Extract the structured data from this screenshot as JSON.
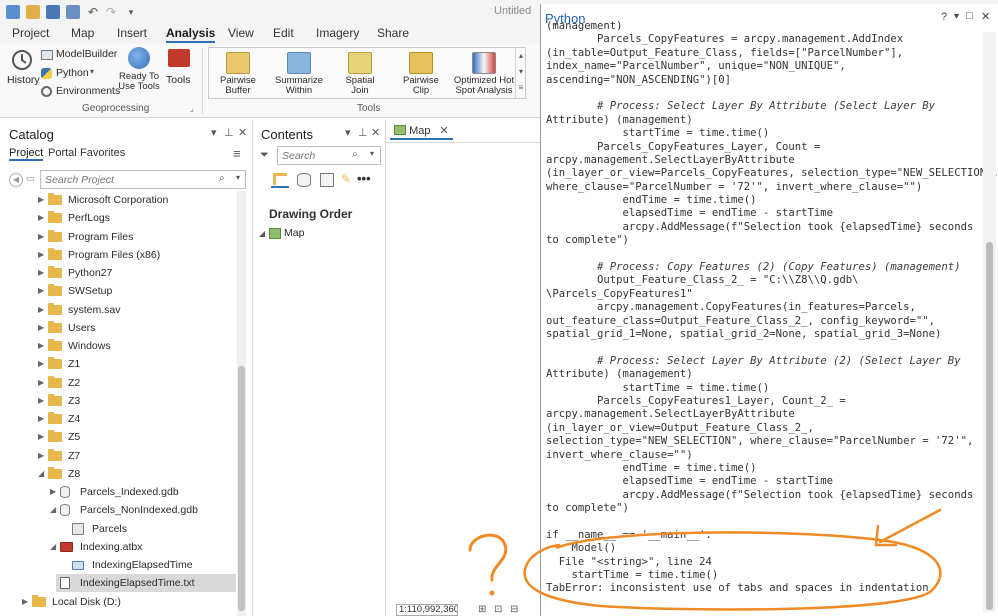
{
  "window": {
    "title": "Untitled",
    "quick_access": [
      "new-project-icon",
      "open-project-icon",
      "save-icon",
      "save-as-icon",
      "undo-icon",
      "redo-icon",
      "customize-icon"
    ]
  },
  "ribbon": {
    "tabs": [
      "Project",
      "Map",
      "Insert",
      "Analysis",
      "View",
      "Edit",
      "Imagery",
      "Share"
    ],
    "active_tab": "Analysis",
    "history_label": "History",
    "modelbuilder_label": "ModelBuilder",
    "python_label": "Python",
    "environments_label": "Environments",
    "ready_to_use_label": "Ready To\nUse Tools",
    "tools_label": "Tools",
    "geoprocessing_group": "Geoprocessing",
    "tools_group": "Tools",
    "tool_gallery": [
      {
        "label": "Pairwise\nBuffer"
      },
      {
        "label": "Summarize\nWithin"
      },
      {
        "label": "Spatial\nJoin"
      },
      {
        "label": "Pairwise\nClip"
      },
      {
        "label": "Optimized Hot\nSpot Analysis"
      }
    ]
  },
  "catalog": {
    "title": "Catalog",
    "subtabs": [
      "Project",
      "Portal",
      "Favorites"
    ],
    "search_placeholder": "Search Project",
    "items": [
      {
        "label": "Microsoft Corporation",
        "type": "folder",
        "indent": 0,
        "expanded": false
      },
      {
        "label": "PerfLogs",
        "type": "folder",
        "indent": 0,
        "expanded": false
      },
      {
        "label": "Program Files",
        "type": "folder",
        "indent": 0,
        "expanded": false
      },
      {
        "label": "Program Files (x86)",
        "type": "folder",
        "indent": 0,
        "expanded": false
      },
      {
        "label": "Python27",
        "type": "folder",
        "indent": 0,
        "expanded": false
      },
      {
        "label": "SWSetup",
        "type": "folder",
        "indent": 0,
        "expanded": false
      },
      {
        "label": "system.sav",
        "type": "folder",
        "indent": 0,
        "expanded": false
      },
      {
        "label": "Users",
        "type": "folder",
        "indent": 0,
        "expanded": false
      },
      {
        "label": "Windows",
        "type": "folder",
        "indent": 0,
        "expanded": false
      },
      {
        "label": "Z1",
        "type": "folder",
        "indent": 0,
        "expanded": false
      },
      {
        "label": "Z2",
        "type": "folder",
        "indent": 0,
        "expanded": false
      },
      {
        "label": "Z3",
        "type": "folder",
        "indent": 0,
        "expanded": false
      },
      {
        "label": "Z4",
        "type": "folder",
        "indent": 0,
        "expanded": false
      },
      {
        "label": "Z5",
        "type": "folder",
        "indent": 0,
        "expanded": false
      },
      {
        "label": "Z7",
        "type": "folder",
        "indent": 0,
        "expanded": false
      },
      {
        "label": "Z8",
        "type": "folder",
        "indent": 0,
        "expanded": true
      },
      {
        "label": "Parcels_Indexed.gdb",
        "type": "gdb",
        "indent": 1,
        "expanded": false
      },
      {
        "label": "Parcels_NonIndexed.gdb",
        "type": "gdb",
        "indent": 1,
        "expanded": true
      },
      {
        "label": "Parcels",
        "type": "featureclass",
        "indent": 2,
        "expanded": null
      },
      {
        "label": "Indexing.atbx",
        "type": "toolbox",
        "indent": 1,
        "expanded": true
      },
      {
        "label": "IndexingElapsedTime",
        "type": "model",
        "indent": 2,
        "expanded": null
      },
      {
        "label": "IndexingElapsedTime.txt",
        "type": "file",
        "indent": 1,
        "expanded": null,
        "selected": true
      },
      {
        "label": "Local Disk (D:)",
        "type": "drive",
        "indent": -1,
        "expanded": false
      }
    ]
  },
  "contents": {
    "title": "Contents",
    "search_placeholder": "Search",
    "drawing_order_label": "Drawing Order",
    "map_item": "Map"
  },
  "mapview": {
    "tab_label": "Map",
    "scale": "1:110,992,360"
  },
  "python": {
    "title": "Python",
    "controls": [
      "?",
      "▾",
      "□",
      "✕"
    ],
    "code_lines": [
      "(management)",
      "        Parcels_CopyFeatures = arcpy.management.AddIndex",
      "(in_table=Output_Feature_Class, fields=[\"ParcelNumber\"],",
      "index_name=\"ParcelNumber\", unique=\"NON_UNIQUE\",",
      "ascending=\"NON_ASCENDING\")[0]",
      "",
      "        # Process: Select Layer By Attribute (Select Layer By",
      "Attribute) (management)",
      "            startTime = time.time()",
      "        Parcels_CopyFeatures_Layer, Count =",
      "arcpy.management.SelectLayerByAttribute",
      "(in_layer_or_view=Parcels_CopyFeatures, selection_type=\"NEW_SELECTION\",",
      "where_clause=\"ParcelNumber = '72'\", invert_where_clause=\"\")",
      "            endTime = time.time()",
      "            elapsedTime = endTime - startTime",
      "            arcpy.AddMessage(f\"Selection took {elapsedTime} seconds",
      "to complete\")",
      "",
      "        # Process: Copy Features (2) (Copy Features) (management)",
      "        Output_Feature_Class_2_ = \"C:\\\\Z8\\\\Q.gdb\\",
      "\\Parcels_CopyFeatures1\"",
      "        arcpy.management.CopyFeatures(in_features=Parcels,",
      "out_feature_class=Output_Feature_Class_2_, config_keyword=\"\",",
      "spatial_grid_1=None, spatial_grid_2=None, spatial_grid_3=None)",
      "",
      "        # Process: Select Layer By Attribute (2) (Select Layer By",
      "Attribute) (management)",
      "            startTime = time.time()",
      "        Parcels_CopyFeatures1_Layer, Count_2_ =",
      "arcpy.management.SelectLayerByAttribute",
      "(in_layer_or_view=Output_Feature_Class_2_,",
      "selection_type=\"NEW_SELECTION\", where_clause=\"ParcelNumber = '72'\",",
      "invert_where_clause=\"\")",
      "            endTime = time.time()",
      "            elapsedTime = endTime - startTime",
      "            arcpy.AddMessage(f\"Selection took {elapsedTime} seconds",
      "to complete\")",
      "",
      "if __name__ == '__main__':",
      "    Model()",
      "  File \"<string>\", line 24",
      "    startTime = time.time()",
      "TabError: inconsistent use of tabs and spaces in indentation"
    ]
  },
  "colors": {
    "accent": "#2e6fb5",
    "annotation": "#f08a24",
    "folder": "#e6b74b"
  }
}
